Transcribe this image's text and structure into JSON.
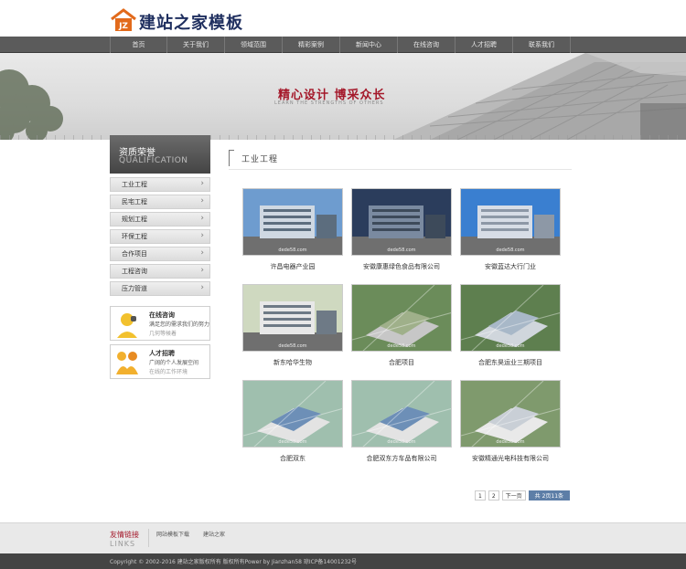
{
  "site": {
    "logo_mark": "JZ",
    "logo_text": "建站之家模板"
  },
  "nav": {
    "items": [
      "首页",
      "关于我们",
      "领域范围",
      "精彩案例",
      "新闻中心",
      "在线咨询",
      "人才招聘",
      "联系我们"
    ]
  },
  "banner": {
    "title": "精心设计 博采众长",
    "subtitle": "LEARN THE STRENGTHS OF OTHERS"
  },
  "sidebar": {
    "title_cn": "资质荣誉",
    "title_en": "QUALIFICATION",
    "items": [
      "工业工程",
      "民宅工程",
      "规划工程",
      "环保工程",
      "合作项目",
      "工程咨询",
      "压力管道"
    ],
    "consult": {
      "title": "在线咨询",
      "line1": "满足您的需求我们的努力",
      "line2": "几何等候着"
    },
    "jobs": {
      "title": "人才招聘",
      "line1": "广阔的个人发展空间",
      "line2": "在线的工作环境"
    }
  },
  "main": {
    "section_title": "工业工程",
    "watermark": "dede58.com",
    "cards": [
      {
        "caption": "许昌电器产业园",
        "icon": "industrial-park-photo"
      },
      {
        "caption": "安徽康惠绿色食品有限公司",
        "icon": "factory-building-photo"
      },
      {
        "caption": "安徽蓝达大行门业",
        "icon": "office-building-photo"
      },
      {
        "caption": "新东哈华生物",
        "icon": "building-photo"
      },
      {
        "caption": "合肥项目",
        "icon": "aerial-site-photo"
      },
      {
        "caption": "合肥东昊运业三期项目",
        "icon": "aerial-site-photo"
      },
      {
        "caption": "合肥双东",
        "icon": "aerial-factory-photo"
      },
      {
        "caption": "合肥双东方车品有限公司",
        "icon": "aerial-factory-photo"
      },
      {
        "caption": "安徽精通光电科技有限公司",
        "icon": "aerial-site-photo"
      }
    ]
  },
  "pagination": {
    "pages": [
      "1",
      "2",
      "下一页"
    ],
    "total": "共 2页11条"
  },
  "footer": {
    "links_title_cn": "友情链接",
    "links_title_en": "LINKS",
    "links": [
      "网站模板下载",
      "建站之家"
    ],
    "copyright": "Copyright © 2002-2016 建站之家版权所有 版权所有Power by Jianzhan58 琼ICP备14001232号"
  },
  "colors": {
    "brand_red": "#a4182a",
    "nav_gray": "#5b5b5b",
    "accent_blue": "#5d7ea7"
  }
}
